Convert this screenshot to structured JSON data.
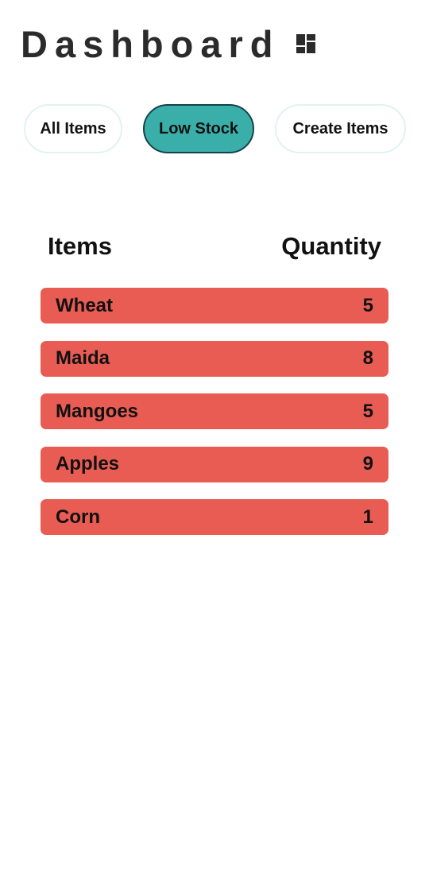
{
  "header": {
    "title": "Dashboard",
    "icon": "dashboard-icon"
  },
  "tabs": [
    {
      "label": "All Items",
      "active": false
    },
    {
      "label": "Low Stock",
      "active": true
    },
    {
      "label": "Create Items",
      "active": false
    }
  ],
  "table": {
    "columns": [
      "Items",
      "Quantity"
    ],
    "rows": [
      {
        "item": "Wheat",
        "quantity": "5"
      },
      {
        "item": "Maida",
        "quantity": "8"
      },
      {
        "item": "Mangoes",
        "quantity": "5"
      },
      {
        "item": "Apples",
        "quantity": "9"
      },
      {
        "item": "Corn",
        "quantity": "1"
      }
    ]
  },
  "colors": {
    "active_tab": "#3aafa9",
    "active_tab_border": "#17424d",
    "tab_border": "#e0f2f2",
    "low_stock_row": "#e85c54",
    "title": "#2b2b2b"
  }
}
